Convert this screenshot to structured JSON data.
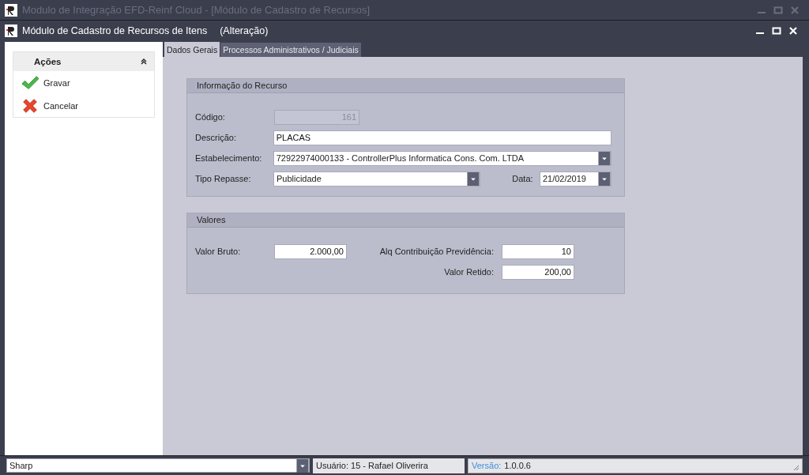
{
  "outer_window": {
    "title": "Modulo de Integração EFD-Reinf Cloud - [Módulo de Cadastro de Recursos]"
  },
  "inner_window": {
    "title": "Módulo de Cadastro de Recursos de Itens",
    "mode": "(Alteração)"
  },
  "actions_panel": {
    "title": "Ações",
    "items": [
      {
        "label": "Gravar",
        "kind": "check"
      },
      {
        "label": "Cancelar",
        "kind": "cross"
      }
    ]
  },
  "tabs": [
    {
      "label": "Dados Gerais",
      "selected": true
    },
    {
      "label": "Processos Administrativos / Judiciais",
      "selected": false
    }
  ],
  "info_section": {
    "title": "Informação do Recurso",
    "codigo": {
      "label": "Código:",
      "value": "161",
      "disabled": true
    },
    "descricao": {
      "label": "Descrição:",
      "value": "PLACAS"
    },
    "estabelecimento": {
      "label": "Estabelecimento:",
      "value": "72922974000133 - ControllerPlus Informatica Cons. Com. LTDA"
    },
    "tipo_repasse": {
      "label": "Tipo Repasse:",
      "value": "Publicidade"
    },
    "data": {
      "label": "Data:",
      "value": "21/02/2019"
    }
  },
  "values_section": {
    "title": "Valores",
    "valor_bruto": {
      "label": "Valor Bruto:",
      "value": "2.000,00"
    },
    "aliquota": {
      "label": "Alq Contribuição Previdência:",
      "value": "10"
    },
    "valor_retido": {
      "label": "Valor Retido:",
      "value": "200,00"
    }
  },
  "status_bar": {
    "skin": "Sharp",
    "user": "Usuário: 15 - Rafael Oliverira",
    "version_label": "Versão:",
    "version": "1.0.0.6"
  }
}
